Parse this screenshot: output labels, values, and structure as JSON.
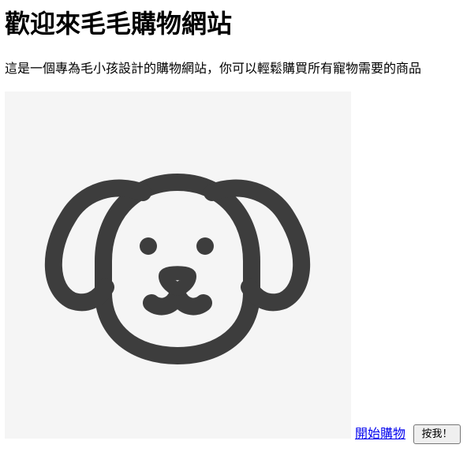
{
  "page": {
    "heading": "歡迎來毛毛購物網站",
    "intro": "這是一個專為毛小孩設計的購物網站，你可以輕鬆購買所有寵物需要的商品"
  },
  "hero": {
    "icon": "dog-face-icon",
    "background": "#f5f5f5",
    "stroke_color": "#3d3d3d"
  },
  "actions": {
    "shop_link_label": "開始購物",
    "button_label": "按我！"
  }
}
